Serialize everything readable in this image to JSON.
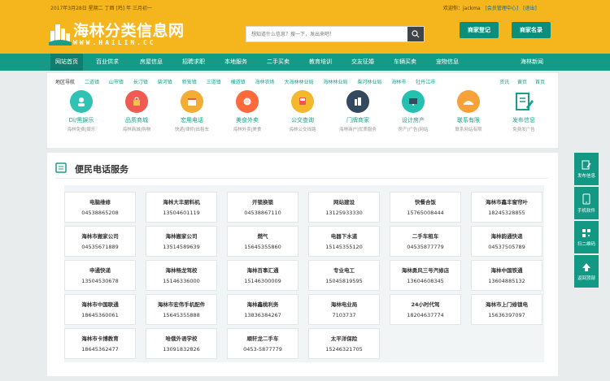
{
  "topbar": {
    "date": "2017年3月28日 星期二  丁酉 [鸡] 年 三月初一",
    "welcome": "欢迎你：jackma",
    "member_link": "[会员管理中心]",
    "logout_link": "[退出]"
  },
  "logo": {
    "name": "海林分类信息网",
    "domain": "WWW.HAILIN.CC"
  },
  "search": {
    "placeholder": "想知道什么信息？搜一下，发出来吧！"
  },
  "header_buttons": [
    "商家登记",
    "商家名录"
  ],
  "nav": {
    "items": [
      "网站首页",
      "百业供求",
      "房屋信息",
      "招聘求职",
      "本地服务",
      "二手买卖",
      "教育培训",
      "交友征婚",
      "车辆买卖",
      "宠物信息"
    ],
    "right": "海林新闻"
  },
  "subnav": {
    "items": [
      "地区导航",
      "二道镇",
      "山市镇",
      "长汀镇",
      "柴河镇",
      "新安镇",
      "三道镇",
      "横道镇",
      "海林农场",
      "大海林林业局",
      "海林林业局",
      "柴河林业局",
      "海林市",
      "牡丹江市"
    ],
    "right": [
      "资讯",
      "黄页",
      "首页"
    ]
  },
  "categories": [
    {
      "title": "Dl/黑娱乐",
      "sub": "海林免费|娱乐",
      "icon": "entertainment-icon",
      "color": "#2ec3b3"
    },
    {
      "title": "品质商城",
      "sub": "海林商城|购物",
      "icon": "shopping-bag-icon",
      "color": "#ef5a52"
    },
    {
      "title": "宏用电话",
      "sub": "快递|律师|出租车",
      "icon": "calendar-icon",
      "color": "#f3ad34"
    },
    {
      "title": "美食外卖",
      "sub": "海林外卖|美食",
      "icon": "food-icon",
      "color": "#ff6a3d"
    },
    {
      "title": "公交查询",
      "sub": "海林公交线路",
      "icon": "bus-icon",
      "color": "#f3b82c"
    },
    {
      "title": "门牌商家",
      "sub": "海林商户|优质服务",
      "icon": "building-icon",
      "color": "#33495e"
    },
    {
      "title": "设计房产",
      "sub": "房产|广告|网站",
      "icon": "monitor-icon",
      "color": "#25c1b0"
    },
    {
      "title": "联系有限",
      "sub": "联系网站有限",
      "icon": "hat-icon",
      "color": "#f6a13a"
    },
    {
      "title": "发布信息",
      "sub": "免费发广告",
      "icon": "edit-icon",
      "color": "#1a9e8b"
    }
  ],
  "service": {
    "title": "便民电话服务",
    "rows": [
      [
        {
          "name": "电脑维修",
          "phone": "04538865208"
        },
        {
          "name": "海林大丰厨料机",
          "phone": "13504601119"
        },
        {
          "name": "开锁换锁",
          "phone": "04538867110"
        },
        {
          "name": "网站建设",
          "phone": "13125933330"
        },
        {
          "name": "快餐合饭",
          "phone": "15765008444"
        },
        {
          "name": "海林市鑫丰窗帘叶",
          "phone": "18245328855"
        }
      ],
      [
        {
          "name": "海林市搬家公司",
          "phone": "04535671889"
        },
        {
          "name": "海林搬家公司",
          "phone": "13514589639"
        },
        {
          "name": "燃气",
          "phone": "15645355860"
        },
        {
          "name": "电器下水道",
          "phone": "15145355120"
        },
        {
          "name": "二手车租车",
          "phone": "04535877779"
        },
        {
          "name": "海林韵通快递",
          "phone": "04537505789"
        }
      ],
      [
        {
          "name": "申通快递",
          "phone": "13504530678"
        },
        {
          "name": "海林畅龙驾校",
          "phone": "15146336000"
        },
        {
          "name": "海林百事汇通",
          "phone": "15146300009"
        },
        {
          "name": "专业电工",
          "phone": "15045819595"
        },
        {
          "name": "海林勇风三号汽修店",
          "phone": "13604608345"
        },
        {
          "name": "海林中国铁通",
          "phone": "13604885132"
        }
      ],
      [
        {
          "name": "海林市中国联通",
          "phone": "18645360061"
        },
        {
          "name": "海林市宏伟手机配件",
          "phone": "15645355888"
        },
        {
          "name": "海林鑫桃利务",
          "phone": "13836384267"
        },
        {
          "name": "海林电业局",
          "phone": "7103737"
        },
        {
          "name": "24小时代驾",
          "phone": "18204637774"
        },
        {
          "name": "海林市上门修锁电",
          "phone": "15636397097"
        }
      ],
      [
        {
          "name": "海林市卡博教育",
          "phone": "18645362477"
        },
        {
          "name": "哈俄外语学校",
          "phone": "13091832826"
        },
        {
          "name": "顺轩龙二手车",
          "phone": "0453-5877779"
        },
        {
          "name": "太平洋保险",
          "phone": "15246321705"
        }
      ]
    ]
  },
  "float": [
    "发布信息",
    "手机软件",
    "扫二维码",
    "返回顶部"
  ]
}
